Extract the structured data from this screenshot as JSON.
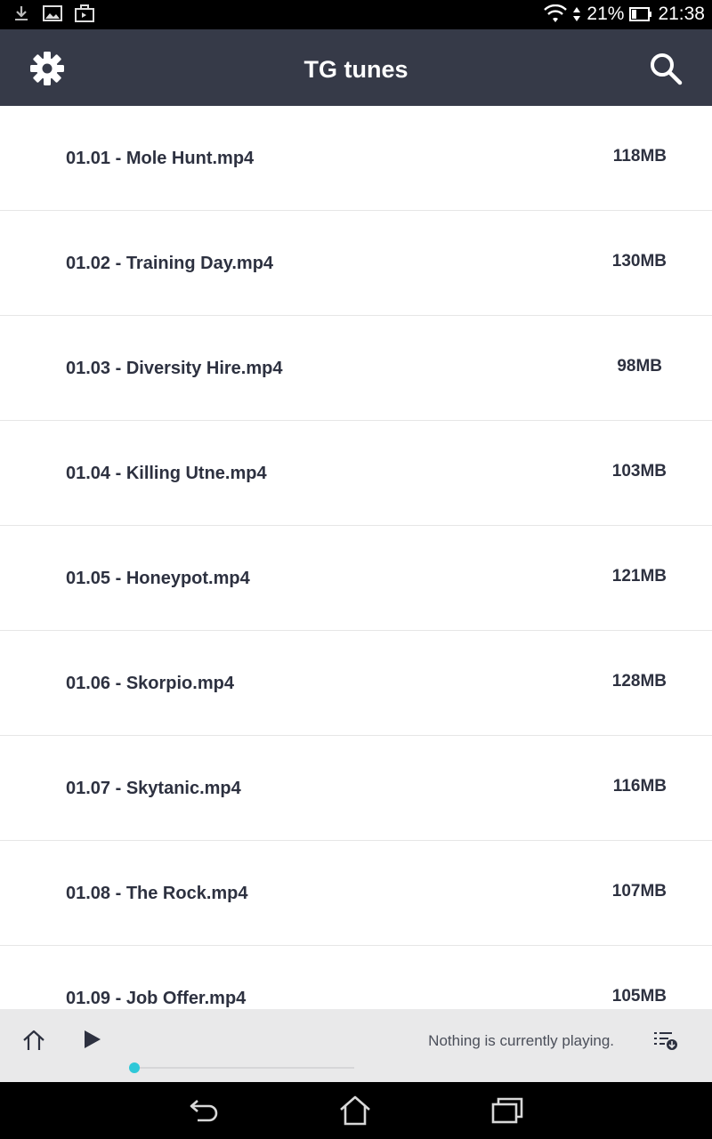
{
  "status_bar": {
    "battery": "21%",
    "time": "21:38",
    "icons": [
      "download-icon",
      "image-icon",
      "briefcase-icon",
      "wifi-icon",
      "signal-arrows-icon",
      "battery-icon"
    ]
  },
  "app_bar": {
    "title": "TG tunes",
    "left_icon": "gear-icon",
    "right_icon": "search-icon"
  },
  "files": [
    {
      "name": "01.01 - Mole Hunt.mp4",
      "size": "118MB"
    },
    {
      "name": "01.02 - Training Day.mp4",
      "size": "130MB"
    },
    {
      "name": "01.03 - Diversity Hire.mp4",
      "size": "98MB"
    },
    {
      "name": "01.04 - Killing Utne.mp4",
      "size": "103MB"
    },
    {
      "name": "01.05 - Honeypot.mp4",
      "size": "121MB"
    },
    {
      "name": "01.06 - Skorpio.mp4",
      "size": "128MB"
    },
    {
      "name": "01.07 - Skytanic.mp4",
      "size": "116MB"
    },
    {
      "name": "01.08 - The Rock.mp4",
      "size": "107MB"
    },
    {
      "name": "01.09 - Job Offer.mp4",
      "size": "105MB"
    }
  ],
  "player": {
    "status_text": "Nothing is currently playing.",
    "progress": 0,
    "accent_color": "#2fc8d8"
  },
  "nav": {
    "icons": [
      "back-icon",
      "home-icon",
      "recent-apps-icon"
    ]
  }
}
